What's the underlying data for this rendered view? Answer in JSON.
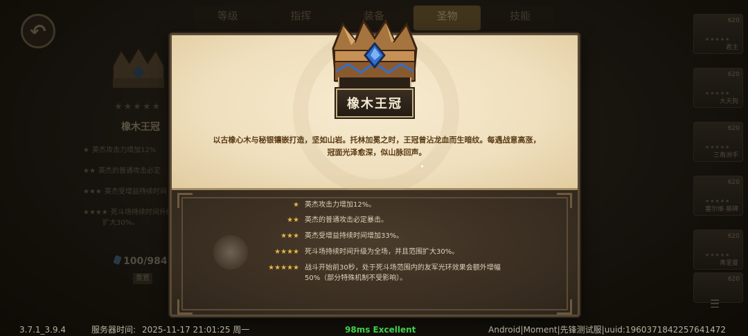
{
  "background": {
    "top_tabs": [
      "等级",
      "指挥",
      "装备",
      "圣物",
      "技能"
    ],
    "active_tab_index": 3,
    "left_panel": {
      "relic_name": "橡木王冠",
      "star_rows": [
        {
          "stars": "★",
          "text": "英杰攻击力增加12%"
        },
        {
          "stars": "★★",
          "text": "英杰的普通攻击必定"
        },
        {
          "stars": "★★★",
          "text": "英杰受增益持续时间"
        },
        {
          "stars": "★★★★",
          "text": "死斗场持续时间升级"
        }
      ],
      "star_row_4_tail": "扩大30%。",
      "count": "100/984",
      "reset_label": "重置"
    },
    "heroes": [
      {
        "level": "620",
        "name": "君主"
      },
      {
        "level": "620",
        "name": "大天狗"
      },
      {
        "level": "620",
        "name": "三角洲手"
      },
      {
        "level": "620",
        "name": "塞尔维·墓碑"
      },
      {
        "level": "620",
        "name": "弗里曼"
      },
      {
        "level": "620",
        "name": ""
      }
    ]
  },
  "modal": {
    "title": "橡木王冠",
    "description": "以古橡心木与秘银镶嵌打造，坚如山岩。托林加冕之时，王冠曾沾龙血而生暗纹。每遇战意高涨，冠面光泽愈深，似山脉回声。",
    "star_rows": [
      {
        "stars": "★",
        "text": "英杰攻击力增加12%。"
      },
      {
        "stars": "★★",
        "text": "英杰的普通攻击必定暴击。"
      },
      {
        "stars": "★★★",
        "text": "英杰受增益持续时间增加33%。"
      },
      {
        "stars": "★★★★",
        "text": "死斗场持续时间升级为全场，并且范围扩大30%。"
      },
      {
        "stars": "★★★★★",
        "text": "战斗开始前30秒，处于死斗场范围内的友军光环效果会额外增幅50%（部分特殊机制不受影响）。"
      }
    ]
  },
  "status_bar": {
    "version": "3.7.1_3.9.4",
    "server_time_label": "服务器时间:",
    "server_time": "2025-11-17  21:01:25  周一",
    "ping": "98ms Excellent",
    "device_info": "Android|Moment|先锋测试服|uuid:1960371842257641472"
  },
  "colors": {
    "accent_gold": "#e0b548",
    "parchment": "#efdfbd",
    "description_text": "#5a3a14",
    "ping_green": "#3ed04a",
    "gem_blue": "#2f6fd0"
  },
  "icons": [
    "back-arrow-icon",
    "crown-icon",
    "gem-icon",
    "menu-icon",
    "star-icon"
  ]
}
